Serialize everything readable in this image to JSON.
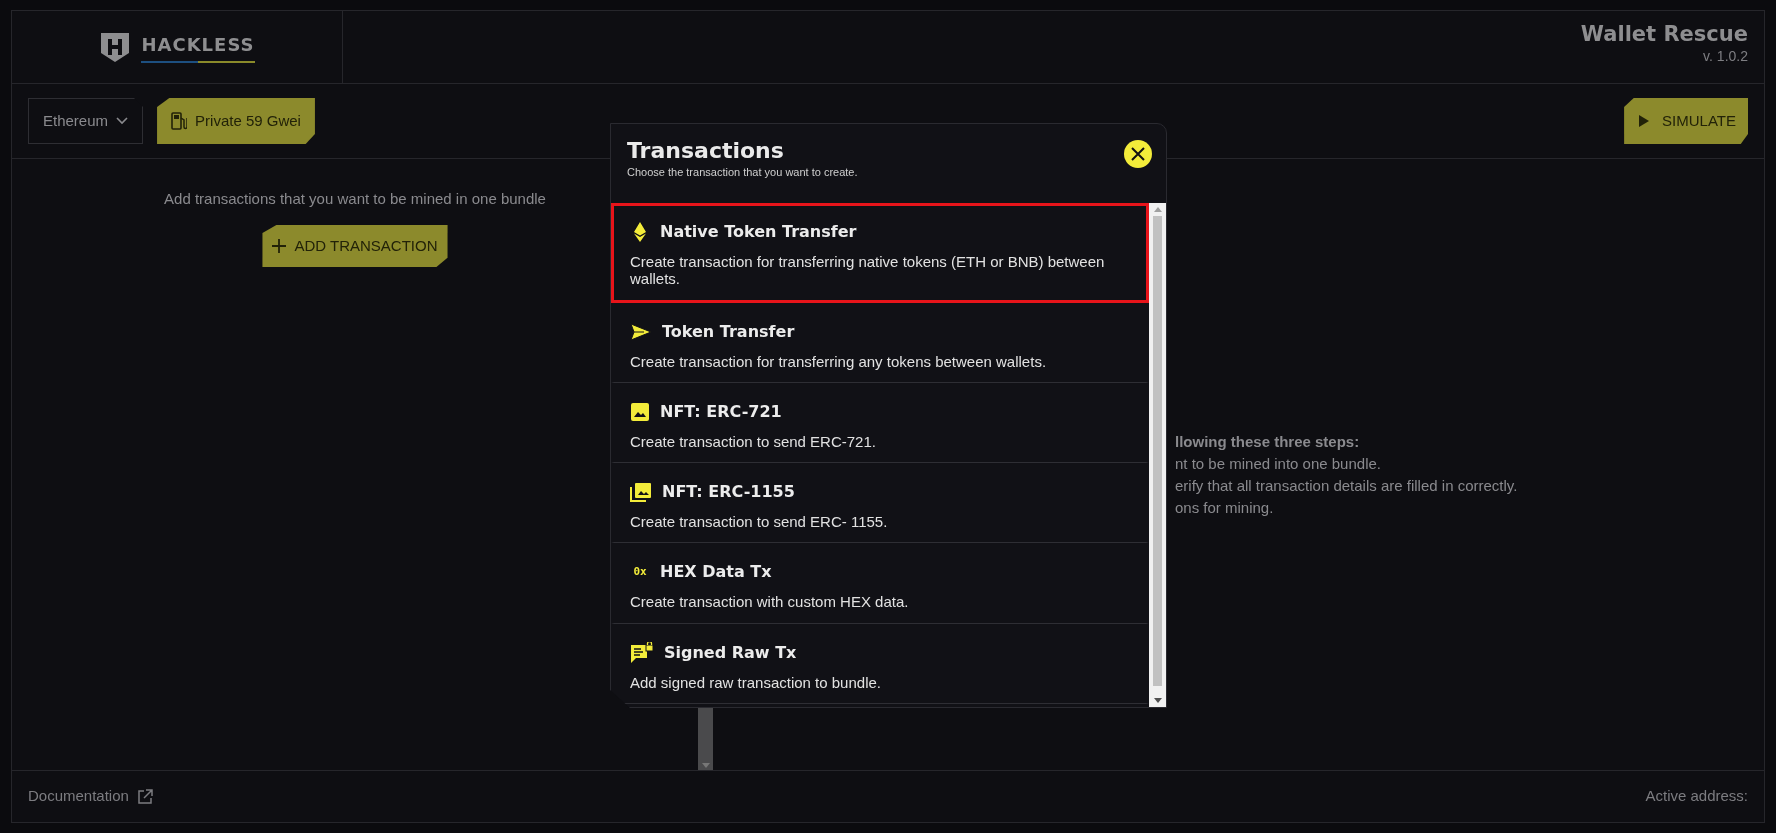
{
  "header": {
    "logo": "HACKLESS",
    "app_title": "Wallet Rescue",
    "version": "v. 1.0.2"
  },
  "toolbar": {
    "network": "Ethereum",
    "gas": "Private 59 Gwei",
    "simulate": "SIMULATE"
  },
  "left_pane": {
    "hint": "Add transactions that you want to be mined in one bundle",
    "add_button": "ADD TRANSACTION"
  },
  "right_pane": {
    "heading": "llowing these three steps:",
    "lines": [
      "nt to be mined into one bundle.",
      "erify that all transaction details are filled in correctly.",
      "ons for mining."
    ]
  },
  "modal": {
    "title": "Transactions",
    "subtitle": "Choose the transaction that you want to create.",
    "items": [
      {
        "kind": "eth",
        "title": "Native Token Transfer",
        "description": "Create transaction for transferring native tokens (ETH or BNB) between wallets.",
        "selected": true
      },
      {
        "kind": "send",
        "title": "Token Transfer",
        "description": "Create transaction for transferring any tokens between wallets.",
        "selected": false
      },
      {
        "kind": "image",
        "title": "NFT: ERC-721",
        "description": "Create transaction to send ERC-721.",
        "selected": false
      },
      {
        "kind": "images",
        "title": "NFT: ERC-1155",
        "description": "Create transaction to send ERC- 1155.",
        "selected": false
      },
      {
        "kind": "hex",
        "icon_text": "0x",
        "title": "HEX Data Tx",
        "description": "Create transaction with custom HEX data.",
        "selected": false
      },
      {
        "kind": "signed",
        "title": "Signed Raw Tx",
        "description": "Add signed raw transaction to bundle.",
        "selected": false
      }
    ]
  },
  "footer": {
    "documentation": "Documentation",
    "active_address": "Active address:"
  }
}
